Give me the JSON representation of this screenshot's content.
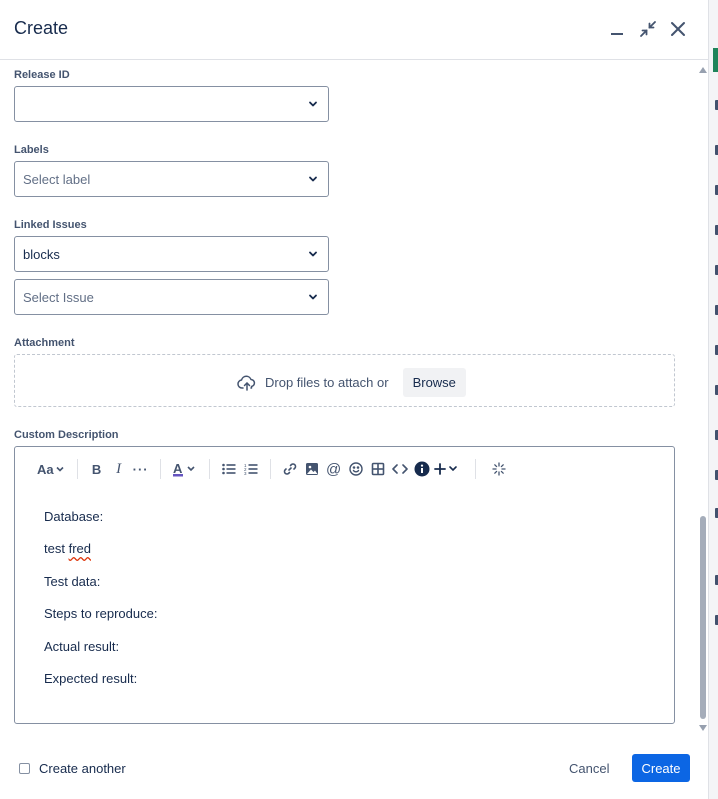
{
  "dialog": {
    "title": "Create"
  },
  "fields": {
    "release_id": {
      "label": "Release ID",
      "value": ""
    },
    "labels": {
      "label": "Labels",
      "placeholder": "Select label"
    },
    "linked_issues": {
      "label": "Linked Issues",
      "relation_value": "blocks",
      "issue_placeholder": "Select Issue"
    },
    "attachment": {
      "label": "Attachment",
      "drop_text": "Drop files to attach or",
      "browse_label": "Browse"
    },
    "custom_description": {
      "label": "Custom Description",
      "toolbar": {
        "text_style": "Aa"
      },
      "lines": [
        "Database:",
        "test fred",
        "Test data:",
        "Steps to reproduce:",
        "Actual result:",
        "Expected result:"
      ]
    }
  },
  "footer": {
    "create_another_label": "Create another",
    "cancel_label": "Cancel",
    "create_label": "Create"
  },
  "colors": {
    "primary": "#0c66e4",
    "text": "#172b4d",
    "subtle_text": "#44546f",
    "border": "#8590a2",
    "spellcheck": "#de350b"
  }
}
